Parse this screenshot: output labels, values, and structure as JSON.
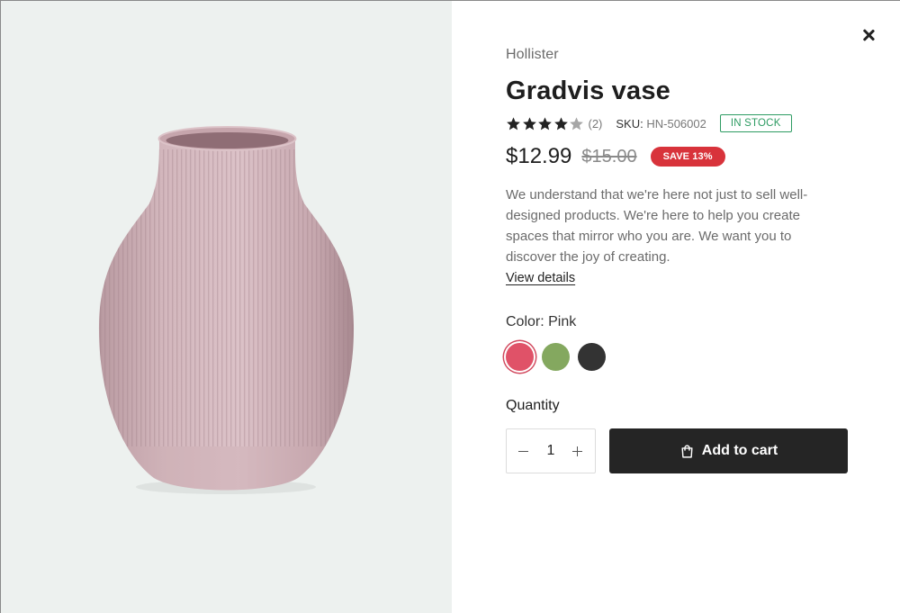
{
  "product": {
    "vendor": "Hollister",
    "title": "Gradvis vase",
    "rating": 4,
    "rating_max": 5,
    "review_count": "(2)",
    "sku_label": "SKU:",
    "sku_value": "HN-506002",
    "stock_status": "IN STOCK",
    "price": "$12.99",
    "compare_price": "$15.00",
    "save_badge": "SAVE 13%",
    "description": "We understand that we're here not just to sell well-designed products. We're here to help you create spaces that mirror who you are. We want you to discover the joy of creating.",
    "view_details": "View details"
  },
  "options": {
    "color_label": "Color: Pink",
    "swatches": [
      {
        "name": "Pink",
        "color": "#e05268",
        "selected": true
      },
      {
        "name": "Green",
        "color": "#84a85f",
        "selected": false
      },
      {
        "name": "Black",
        "color": "#333333",
        "selected": false
      }
    ]
  },
  "quantity": {
    "label": "Quantity",
    "value": "1"
  },
  "actions": {
    "add_to_cart": "Add to cart",
    "close_icon": "close-icon"
  },
  "colors": {
    "image_background": "#edf1ef",
    "stock_green": "#2d9b62",
    "sale_red": "#d8333b",
    "button_dark": "#252525",
    "vase_pink": "#d6b9bf"
  }
}
